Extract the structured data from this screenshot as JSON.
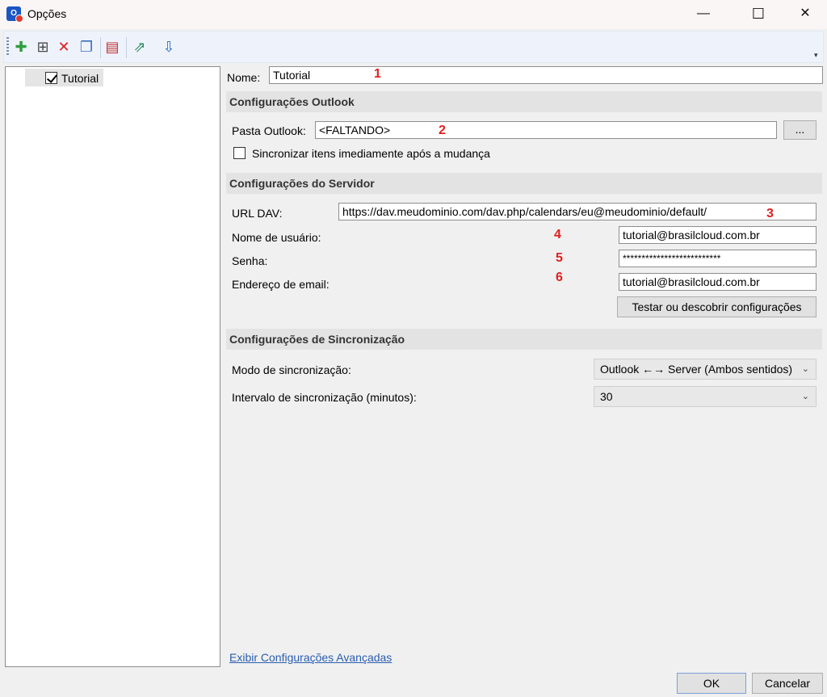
{
  "window": {
    "title": "Opções",
    "app_icon": "O"
  },
  "window_controls": {
    "minimize": "—",
    "maximize": "☐",
    "close": "✕"
  },
  "toolbar": {
    "icons": [
      {
        "name": "add-icon",
        "glyph": "✚",
        "color": "#2e9e3e"
      },
      {
        "name": "add-multiple-icon",
        "glyph": "⊞",
        "color": "#4a4a4a"
      },
      {
        "name": "delete-icon",
        "glyph": "✕",
        "color": "#e02020"
      },
      {
        "name": "copy-icon",
        "glyph": "❐",
        "color": "#3a6cc0"
      },
      {
        "name": "clear-cache-icon",
        "glyph": "▤",
        "color": "#c03030"
      },
      {
        "name": "export-icon",
        "glyph": "⇗",
        "color": "#2b8a5a"
      },
      {
        "name": "import-icon",
        "glyph": "⇩",
        "color": "#2a6cc8"
      }
    ],
    "overflow": "▾"
  },
  "tree": {
    "items": [
      {
        "label": "Tutorial",
        "checked": true
      }
    ]
  },
  "form": {
    "name_label": "Nome:",
    "name_value": "Tutorial",
    "outlook_section": "Configurações Outlook",
    "outlook_folder_label": "Pasta Outlook:",
    "outlook_folder_value": "<FALTANDO>",
    "browse_label": "...",
    "sync_immediately_label": "Sincronizar itens imediamente após a mudança",
    "server_section": "Configurações do Servidor",
    "dav_url_label": "URL DAV:",
    "dav_url_value": "https://dav.meudominio.com/dav.php/calendars/eu@meudominio/default/",
    "username_label": "Nome de usuário:",
    "username_value": "tutorial@brasilcloud.com.br",
    "password_label": "Senha:",
    "password_value": "**************************",
    "email_label": "Endereço de email:",
    "email_value": "tutorial@brasilcloud.com.br",
    "test_button": "Testar ou descobrir configurações",
    "sync_section": "Configurações de Sincronização",
    "sync_mode_label": "Modo de sincronização:",
    "sync_mode_value": "Outlook ←→ Server (Ambos sentidos)",
    "sync_interval_label": "Intervalo de sincronização (minutos):",
    "sync_interval_value": "30",
    "advanced_link": "Exibir Configurações Avançadas"
  },
  "annotations": [
    "1",
    "2",
    "3",
    "4",
    "5",
    "6"
  ],
  "footer": {
    "ok": "OK",
    "cancel": "Cancelar"
  },
  "colors": {
    "annotation": "#e0201e",
    "link": "#2a5db0",
    "section_bg": "#e3e3e3"
  }
}
